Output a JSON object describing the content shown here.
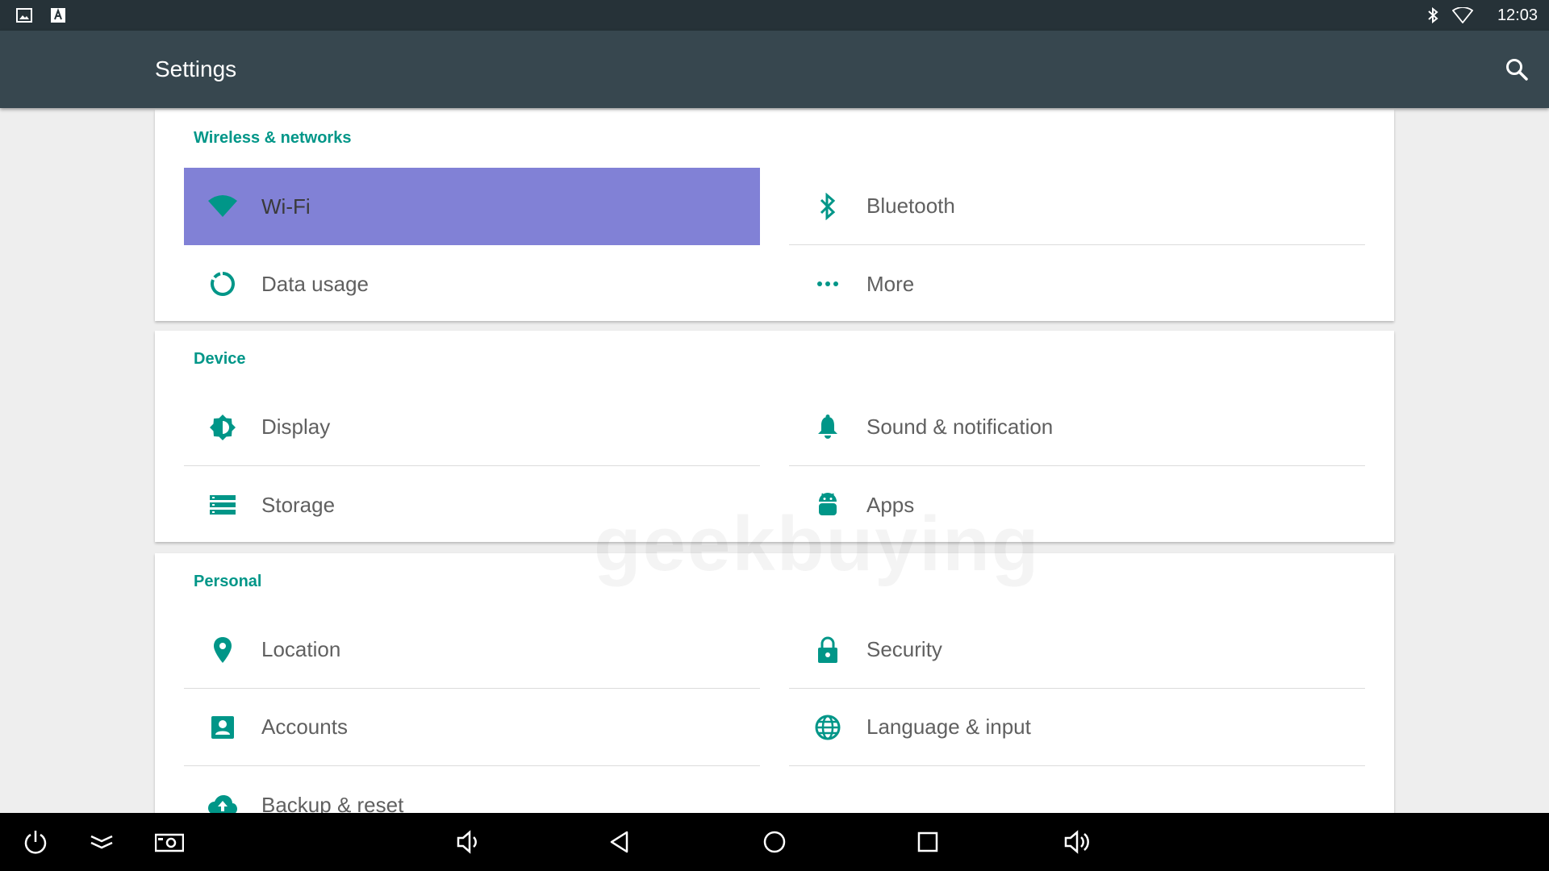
{
  "status_bar": {
    "left_icons": [
      "image-icon",
      "keyboard-a-icon"
    ],
    "right_icons": [
      "bluetooth-status-icon",
      "wifi-status-icon"
    ],
    "time": "12:03"
  },
  "toolbar": {
    "title": "Settings",
    "search_icon": "search-icon"
  },
  "sections": {
    "wireless": {
      "header": "Wireless & networks",
      "items": [
        {
          "label": "Wi-Fi",
          "icon": "wifi-icon",
          "selected": true
        },
        {
          "label": "Bluetooth",
          "icon": "bluetooth-icon"
        },
        {
          "label": "Data usage",
          "icon": "data-usage-icon"
        },
        {
          "label": "More",
          "icon": "more-icon"
        }
      ]
    },
    "device": {
      "header": "Device",
      "items": [
        {
          "label": "Display",
          "icon": "brightness-icon"
        },
        {
          "label": "Sound & notification",
          "icon": "bell-icon"
        },
        {
          "label": "Storage",
          "icon": "storage-icon"
        },
        {
          "label": "Apps",
          "icon": "android-icon"
        }
      ]
    },
    "personal": {
      "header": "Personal",
      "items": [
        {
          "label": "Location",
          "icon": "location-pin-icon"
        },
        {
          "label": "Security",
          "icon": "lock-icon"
        },
        {
          "label": "Accounts",
          "icon": "account-icon"
        },
        {
          "label": "Language & input",
          "icon": "globe-icon"
        },
        {
          "label": "Backup & reset",
          "icon": "cloud-upload-icon"
        }
      ]
    }
  },
  "watermark": "geekbuying",
  "nav_bar": {
    "buttons": [
      "power-icon",
      "collapse-icon",
      "screenshot-icon",
      "volume-down-icon",
      "back-icon",
      "home-icon",
      "recents-icon",
      "volume-up-icon"
    ]
  },
  "colors": {
    "accent": "#009688",
    "selected_tile": "#8181d6",
    "toolbar": "#37474f",
    "status_bar": "#263238",
    "background": "#eeeeee"
  }
}
